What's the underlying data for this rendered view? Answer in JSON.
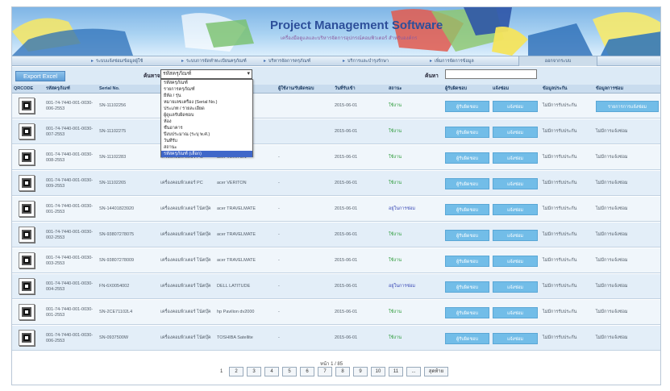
{
  "banner": {
    "title": "Project Management Software",
    "subtitle": "เครื่องมือดูแลและบริหารจัดการอุปกรณ์คอมพิวเตอร์ สำหรับองค์กร"
  },
  "menu": [
    {
      "label": "ระบบแจ้งซ่อม/ข้อมูลผู้ใช้"
    },
    {
      "label": "ระบบการจัดทำทะเบียนครุภัณฑ์"
    },
    {
      "label": "บริหารจัดการครุภัณฑ์"
    },
    {
      "label": "บริการและบำรุงรักษา"
    },
    {
      "label": "เพิ่มการจัดการข้อมูล"
    },
    {
      "label": "ออกจากระบบ"
    }
  ],
  "toolbar": {
    "export_label": "Export Excel",
    "search_by_label": "ค้นหาจาก",
    "search_by_value": "รหัสครุภัณฑ์",
    "keyword_label": "ค้นหา"
  },
  "dropdown": {
    "options": [
      {
        "label": "รหัสครุภัณฑ์",
        "selected": false
      },
      {
        "label": "รายการครุภัณฑ์",
        "selected": false
      },
      {
        "label": "ยี่ห้อ / รุ่น",
        "selected": false
      },
      {
        "label": "หมายเลขเครื่อง (Serial No.)",
        "selected": false
      },
      {
        "label": "ประเภท / รายละเอียด",
        "selected": false
      },
      {
        "label": "ผู้ดูแลรับผิดชอบ",
        "selected": false
      },
      {
        "label": "ห้อง",
        "selected": false
      },
      {
        "label": "ชั้นอาคาร",
        "selected": false
      },
      {
        "label": "ปีงบประมาณ (ระบุ พ.ศ.)",
        "selected": false
      },
      {
        "label": "วันที่รับ",
        "selected": false
      },
      {
        "label": "สถานะ",
        "selected": false
      },
      {
        "label": "รหัสครุภัณฑ์ (เลือก)",
        "selected": true
      }
    ]
  },
  "table": {
    "columns": [
      {
        "label": "QRCODE"
      },
      {
        "label": "รหัสครุภัณฑ์"
      },
      {
        "label": "Serial No."
      },
      {
        "label": ""
      },
      {
        "label": ""
      },
      {
        "label": "ผู้ใช้งาน/รับผิดชอบ"
      },
      {
        "label": "วันที่รับเข้า"
      },
      {
        "label": "สถานะ"
      },
      {
        "label": "ผู้รับผิดชอบ"
      },
      {
        "label": "แจ้งซ่อม"
      },
      {
        "label": "ข้อมูลประกัน"
      },
      {
        "label": "ข้อมูลการซ่อม"
      }
    ],
    "rows": [
      {
        "code": "001-74-7440-001-0030-006-2553",
        "serial": "SN-11102256",
        "type": "",
        "model": "",
        "user": "",
        "date": "2015-06-01",
        "status": "ใช้งาน",
        "status_kind": "green",
        "btn_owner": "ผู้รับผิดชอบ",
        "btn_repair": "แจ้งซ่อม",
        "warranty": "ไม่มีการรับประกัน",
        "repair_info": "รายการการแจ้งซ่อม",
        "repair_is_button": true
      },
      {
        "code": "001-74-7440-001-0030-007-2553",
        "serial": "SN-11102275",
        "type": "",
        "model": "",
        "user": "",
        "date": "2015-06-01",
        "status": "ใช้งาน",
        "status_kind": "green",
        "btn_owner": "ผู้รับผิดชอบ",
        "btn_repair": "แจ้งซ่อม",
        "warranty": "ไม่มีการรับประกัน",
        "repair_info": "ไม่มีการแจ้งซ่อม",
        "repair_is_button": false
      },
      {
        "code": "001-74-7440-001-0030-008-2553",
        "serial": "SN-11102283",
        "type": "เครื่องคอมพิวเตอร์ PC",
        "model": "acer VERITON",
        "user": "-",
        "date": "2015-06-01",
        "status": "ใช้งาน",
        "status_kind": "green",
        "btn_owner": "ผู้รับผิดชอบ",
        "btn_repair": "แจ้งซ่อม",
        "warranty": "ไม่มีการรับประกัน",
        "repair_info": "ไม่มีการแจ้งซ่อม",
        "repair_is_button": false
      },
      {
        "code": "001-74-7440-001-0030-009-2553",
        "serial": "SN-11102265",
        "type": "เครื่องคอมพิวเตอร์ PC",
        "model": "acer VERITON",
        "user": "-",
        "date": "2015-06-01",
        "status": "ใช้งาน",
        "status_kind": "green",
        "btn_owner": "ผู้รับผิดชอบ",
        "btn_repair": "แจ้งซ่อม",
        "warranty": "ไม่มีการรับประกัน",
        "repair_info": "ไม่มีการแจ้งซ่อม",
        "repair_is_button": false
      },
      {
        "code": "001-74-7440-001-0030-001-2553",
        "serial": "SN-14401823920",
        "type": "เครื่องคอมพิวเตอร์ โน้ตบุ๊ค",
        "model": "acer TRAVELMATE",
        "user": "-",
        "date": "2015-06-01",
        "status": "อยู่ในการซ่อม",
        "status_kind": "blue",
        "btn_owner": "ผู้รับผิดชอบ",
        "btn_repair": "แจ้งซ่อม",
        "warranty": "ไม่มีการรับประกัน",
        "repair_info": "ไม่มีการแจ้งซ่อม",
        "repair_is_button": false
      },
      {
        "code": "001-74-7440-001-0030-002-2553",
        "serial": "SN-93807278075",
        "type": "เครื่องคอมพิวเตอร์ โน้ตบุ๊ค",
        "model": "acer TRAVELMATE",
        "user": "-",
        "date": "2015-06-01",
        "status": "ใช้งาน",
        "status_kind": "green",
        "btn_owner": "ผู้รับผิดชอบ",
        "btn_repair": "แจ้งซ่อม",
        "warranty": "ไม่มีการรับประกัน",
        "repair_info": "ไม่มีการแจ้งซ่อม",
        "repair_is_button": false
      },
      {
        "code": "001-74-7440-001-0030-003-2553",
        "serial": "SN-93807278009",
        "type": "เครื่องคอมพิวเตอร์ โน้ตบุ๊ค",
        "model": "acer TRAVELMATE",
        "user": "-",
        "date": "2015-06-01",
        "status": "ใช้งาน",
        "status_kind": "green",
        "btn_owner": "ผู้รับผิดชอบ",
        "btn_repair": "แจ้งซ่อม",
        "warranty": "ไม่มีการรับประกัน",
        "repair_info": "ไม่มีการแจ้งซ่อม",
        "repair_is_button": false
      },
      {
        "code": "001-74-7440-001-0030-004-2553",
        "serial": "FN-6X0054002",
        "type": "เครื่องคอมพิวเตอร์ โน้ตบุ๊ค",
        "model": "DELL LATITUDE",
        "user": "-",
        "date": "2015-06-01",
        "status": "อยู่ในการซ่อม",
        "status_kind": "blue",
        "btn_owner": "ผู้รับผิดชอบ",
        "btn_repair": "แจ้งซ่อม",
        "warranty": "ไม่มีการรับประกัน",
        "repair_info": "ไม่มีการแจ้งซ่อม",
        "repair_is_button": false
      },
      {
        "code": "001-74-7440-001-0030-001-2553",
        "serial": "SN-2CE71102L4",
        "type": "เครื่องคอมพิวเตอร์ โน้ตบุ๊ค",
        "model": "hp Pavilion dv2000",
        "user": "-",
        "date": "2015-06-01",
        "status": "ใช้งาน",
        "status_kind": "green",
        "btn_owner": "ผู้รับผิดชอบ",
        "btn_repair": "แจ้งซ่อม",
        "warranty": "ไม่มีการรับประกัน",
        "repair_info": "ไม่มีการแจ้งซ่อม",
        "repair_is_button": false
      },
      {
        "code": "001-74-7440-001-0030-006-2553",
        "serial": "SN-0937500W",
        "type": "เครื่องคอมพิวเตอร์ โน้ตบุ๊ค",
        "model": "TOSHIBA Satellite",
        "user": "-",
        "date": "2015-06-01",
        "status": "ใช้งาน",
        "status_kind": "green",
        "btn_owner": "ผู้รับผิดชอบ",
        "btn_repair": "แจ้งซ่อม",
        "warranty": "ไม่มีการรับประกัน",
        "repair_info": "ไม่มีการแจ้งซ่อม",
        "repair_is_button": false
      }
    ]
  },
  "pagination": {
    "info": "หน้า 1 / 85",
    "first": "1",
    "pages": [
      "2",
      "3",
      "4",
      "5",
      "6",
      "7",
      "8",
      "9",
      "10",
      "11",
      "..."
    ],
    "last_label": "สุดท้าย"
  },
  "colors": {
    "accent": "#72bde8",
    "status_green": "#2c9b3a",
    "status_blue": "#3a49b6",
    "header_bg": "#c9dcee"
  }
}
